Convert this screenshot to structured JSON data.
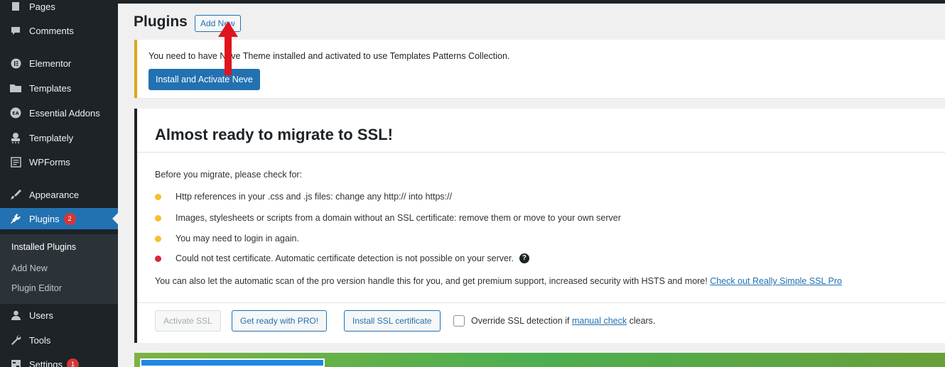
{
  "sidebar": {
    "items": [
      {
        "label": "Pages",
        "icon": "pages-icon"
      },
      {
        "label": "Comments",
        "icon": "comment-icon"
      },
      {
        "label": "Elementor",
        "icon": "elementor-icon"
      },
      {
        "label": "Templates",
        "icon": "folder-icon"
      },
      {
        "label": "Essential Addons",
        "icon": "essential-addons-icon"
      },
      {
        "label": "Templately",
        "icon": "templately-icon"
      },
      {
        "label": "WPForms",
        "icon": "form-icon"
      },
      {
        "label": "Appearance",
        "icon": "paintbrush-icon"
      },
      {
        "label": "Plugins",
        "icon": "plugin-icon",
        "badge": "2"
      },
      {
        "label": "Users",
        "icon": "user-icon"
      },
      {
        "label": "Tools",
        "icon": "wrench-icon"
      },
      {
        "label": "Settings",
        "icon": "settings-icon",
        "badge": "1"
      }
    ],
    "submenu": [
      "Installed Plugins",
      "Add New",
      "Plugin Editor"
    ]
  },
  "header": {
    "title": "Plugins",
    "add_new_label": "Add New"
  },
  "notice": {
    "text": "You need to have Neve Theme installed and activated to use Templates Patterns Collection.",
    "button_label": "Install and Activate Neve"
  },
  "ssl": {
    "title": "Almost ready to migrate to SSL!",
    "intro": "Before you migrate, please check for:",
    "items": [
      {
        "text": "Http references in your .css and .js files: change any http:// into https://",
        "status": "warning"
      },
      {
        "text": "Images, stylesheets or scripts from a domain without an SSL certificate: remove them or move to your own server",
        "status": "warning"
      },
      {
        "text": "You may need to login in again.",
        "status": "warning"
      },
      {
        "text": "Could not test certificate. Automatic certificate detection is not possible on your server.",
        "status": "error"
      }
    ],
    "pro_text": "You can also let the automatic scan of the pro version handle this for you, and get premium support, increased security with HSTS and more!",
    "pro_link": "Check out Really Simple SSL Pro",
    "buttons": {
      "activate": "Activate SSL",
      "pro": "Get ready with PRO!",
      "install": "Install SSL certificate"
    },
    "override_prefix": "Override SSL detection if",
    "override_link": "manual check",
    "override_suffix": "clears."
  },
  "colors": {
    "sidebar_bg": "#1d2327",
    "accent": "#2271b1",
    "warning": "#f8be2e",
    "error": "#d7263d",
    "annotation_arrow": "#e0141e"
  }
}
